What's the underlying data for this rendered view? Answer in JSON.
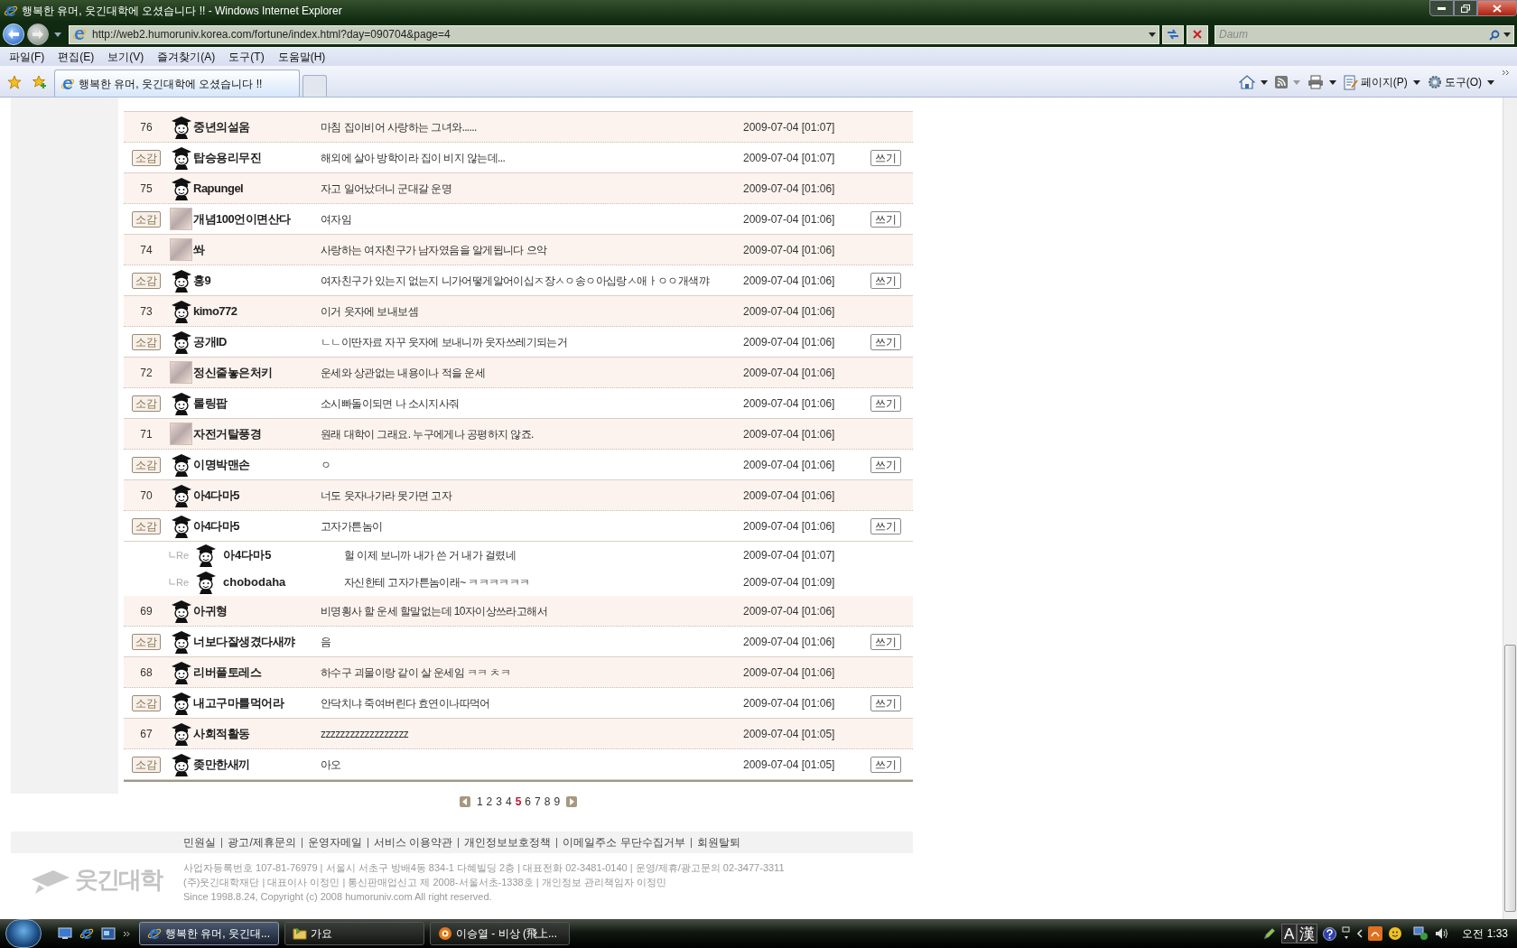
{
  "window": {
    "title": "행복한 유머, 웃긴대학에 오셨습니다 !! - Windows Internet Explorer"
  },
  "address_bar": {
    "url": "http://web2.humoruniv.korea.com/fortune/index.html?day=090704&page=4",
    "search_placeholder": "Daum"
  },
  "menu": [
    "파일(F)",
    "편집(E)",
    "보기(V)",
    "즐겨찾기(A)",
    "도구(T)",
    "도움말(H)"
  ],
  "tabs": [
    {
      "label": "행복한 유머, 웃긴대학에 오셨습니다 !!",
      "selected": true
    }
  ],
  "command_bar": [
    {
      "kind": "home"
    },
    {
      "kind": "feeds"
    },
    {
      "kind": "print"
    },
    {
      "kind": "page",
      "label": "페이지(P)"
    },
    {
      "kind": "tools",
      "label": "도구(O)"
    }
  ],
  "posts": [
    {
      "kind": "post",
      "number": "76",
      "avatar": {
        "kind": "graduate"
      },
      "name": "중년의설움",
      "subject": "마침 집이비어 사랑하는 그녀와......",
      "date": "2009-07-04 [01:07]"
    },
    {
      "kind": "comment",
      "badge": "소감",
      "avatar": {
        "kind": "graduate"
      },
      "name": "탑승용리무진",
      "subject": "해외에 살아 방학이라 집이 비지 않는데...",
      "date": "2009-07-04 [01:07]",
      "action": "쓰기"
    },
    {
      "kind": "post",
      "number": "75",
      "avatar": {
        "kind": "graduate"
      },
      "name": "Rapungel",
      "subject": "자고 일어났더니 군대갈 운명",
      "date": "2009-07-04 [01:06]"
    },
    {
      "kind": "comment",
      "badge": "소감",
      "avatar": {
        "kind": "picture"
      },
      "name": "개념100언이면산다",
      "subject": "여자임",
      "date": "2009-07-04 [01:06]",
      "action": "쓰기"
    },
    {
      "kind": "post",
      "number": "74",
      "avatar": {
        "kind": "picture"
      },
      "name": "쏴",
      "subject": "사랑하는 여자친구가 남자였음을 알게됩니다 으악",
      "date": "2009-07-04 [01:06]"
    },
    {
      "kind": "comment",
      "badge": "소감",
      "avatar": {
        "kind": "graduate"
      },
      "name": "홍9",
      "subject": "여자친구가 있는지 없는지 니가어떻게알어이십ㅈ장ㅅㅇ송ㅇ아십랑ㅅ애ㅏㅇㅇ개색꺄",
      "date": "2009-07-04 [01:06]",
      "action": "쓰기"
    },
    {
      "kind": "post",
      "number": "73",
      "avatar": {
        "kind": "graduate"
      },
      "name": "kimo772",
      "subject": "이거 웃자에 보내보셈",
      "date": "2009-07-04 [01:06]"
    },
    {
      "kind": "comment",
      "badge": "소감",
      "avatar": {
        "kind": "graduate"
      },
      "name": "공개ID",
      "subject": "ㄴㄴ이딴자료 자꾸 웃자에 보내니까 웃자쓰레기되는거",
      "date": "2009-07-04 [01:06]",
      "action": "쓰기"
    },
    {
      "kind": "post",
      "number": "72",
      "avatar": {
        "kind": "picture"
      },
      "name": "정신줄놓은처키",
      "subject": "운세와 상관없는 내용이나 적을 운세",
      "date": "2009-07-04 [01:06]"
    },
    {
      "kind": "comment",
      "badge": "소감",
      "avatar": {
        "kind": "graduate"
      },
      "name": "롤링팝",
      "subject": "소시빠돌이되면 나 소시지사줘",
      "date": "2009-07-04 [01:06]",
      "action": "쓰기"
    },
    {
      "kind": "post",
      "number": "71",
      "avatar": {
        "kind": "picture"
      },
      "name": "자전거탈풍경",
      "subject": "원래 대학이 그래요. 누구에게나 공평하지 않죠.",
      "date": "2009-07-04 [01:06]"
    },
    {
      "kind": "comment",
      "badge": "소감",
      "avatar": {
        "kind": "graduate"
      },
      "name": "이명박맨손",
      "subject": "ㅇ",
      "date": "2009-07-04 [01:06]",
      "action": "쓰기"
    },
    {
      "kind": "post",
      "number": "70",
      "avatar": {
        "kind": "graduate"
      },
      "name": "아4다마5",
      "subject": "너도 웃자나가라 못가면 고자",
      "date": "2009-07-04 [01:06]"
    },
    {
      "kind": "comment",
      "badge": "소감",
      "avatar": {
        "kind": "graduate"
      },
      "name": "아4다마5",
      "subject": "고자가튼놈이",
      "date": "2009-07-04 [01:06]",
      "action": "쓰기"
    },
    {
      "kind": "reply",
      "marker": "Re",
      "avatar": {
        "kind": "graduate"
      },
      "name": "아4다마5",
      "subject": "헐 이제 보니까 내가 쓴 거 내가 걸렸네",
      "date": "2009-07-04 [01:07]"
    },
    {
      "kind": "reply",
      "marker": "Re",
      "avatar": {
        "kind": "graduate"
      },
      "name": "chobodaha",
      "subject": "자신한테 고자가튼놈이래~ ㅋㅋㅋㅋㅋㅋ",
      "date": "2009-07-04 [01:09]"
    },
    {
      "kind": "post",
      "number": "69",
      "avatar": {
        "kind": "graduate"
      },
      "name": "아귀형",
      "subject": "비명횡사 할 운세 할말없는데 10자이상쓰라고해서",
      "date": "2009-07-04 [01:06]"
    },
    {
      "kind": "comment",
      "badge": "소감",
      "avatar": {
        "kind": "graduate"
      },
      "name": "너보다잘생겼다새꺄",
      "subject": "음",
      "date": "2009-07-04 [01:06]",
      "action": "쓰기"
    },
    {
      "kind": "post",
      "number": "68",
      "avatar": {
        "kind": "graduate"
      },
      "name": "리버풀토레스",
      "subject": "하수구 괴물이랑 같이 살 운세임 ㅋㅋ ㅊㅋ",
      "date": "2009-07-04 [01:06]"
    },
    {
      "kind": "comment",
      "badge": "소감",
      "avatar": {
        "kind": "graduate"
      },
      "name": "내고구마를먹어라",
      "subject": "안닥치냐 죽여버린다 효연이나따먹어",
      "date": "2009-07-04 [01:06]",
      "action": "쓰기"
    },
    {
      "kind": "post",
      "number": "67",
      "avatar": {
        "kind": "graduate"
      },
      "name": "사회적활동",
      "subject": "zzzzzzzzzzzzzzzzzz",
      "date": "2009-07-04 [01:05]"
    },
    {
      "kind": "comment",
      "badge": "소감",
      "avatar": {
        "kind": "graduate"
      },
      "name": "좆만한새끼",
      "subject": "아오",
      "date": "2009-07-04 [01:05]",
      "action": "쓰기"
    }
  ],
  "pagination": {
    "pages": [
      {
        "label": "1",
        "selected": false
      },
      {
        "label": "2",
        "selected": false
      },
      {
        "label": "3",
        "selected": false
      },
      {
        "label": "4",
        "selected": false
      },
      {
        "label": "5",
        "selected": true
      },
      {
        "label": "6",
        "selected": false
      },
      {
        "label": "7",
        "selected": false
      },
      {
        "label": "8",
        "selected": false
      },
      {
        "label": "9",
        "selected": false
      }
    ]
  },
  "footer": {
    "links": [
      "민원실",
      "광고/제휴문의",
      "운영자메일",
      "서비스 이용약관",
      "개인정보보호정책",
      "이메일주소 무단수집거부",
      "회원탈퇴"
    ],
    "logo": "웃긴대학",
    "info": [
      "사업자등록번호 107-81-76979 | 서울시 서초구 방배4동 834-1 다혜빌딩 2층 | 대표전화 02-3481-0140 | 운영/제휴/광고문의 02-3477-3311",
      "(주)웃긴대학재단 | 대표이사 이정민 | 통신판매업신고 제 2008-서울서초-1338호 | 개인정보 관리책임자 이정민",
      "Since 1998.8.24, Copyright (c) 2008 humoruniv.com All right reserved."
    ]
  },
  "taskbar": {
    "items": [
      {
        "kind": "browser",
        "label": "행복한 유머, 웃긴대...",
        "selected": true
      },
      {
        "kind": "folder",
        "label": "가요",
        "selected": false
      },
      {
        "kind": "player",
        "label": "이승열 - 비상 (飛上...",
        "selected": false
      }
    ],
    "ime": [
      "A",
      "漢"
    ],
    "clock": "오전 1:33"
  }
}
